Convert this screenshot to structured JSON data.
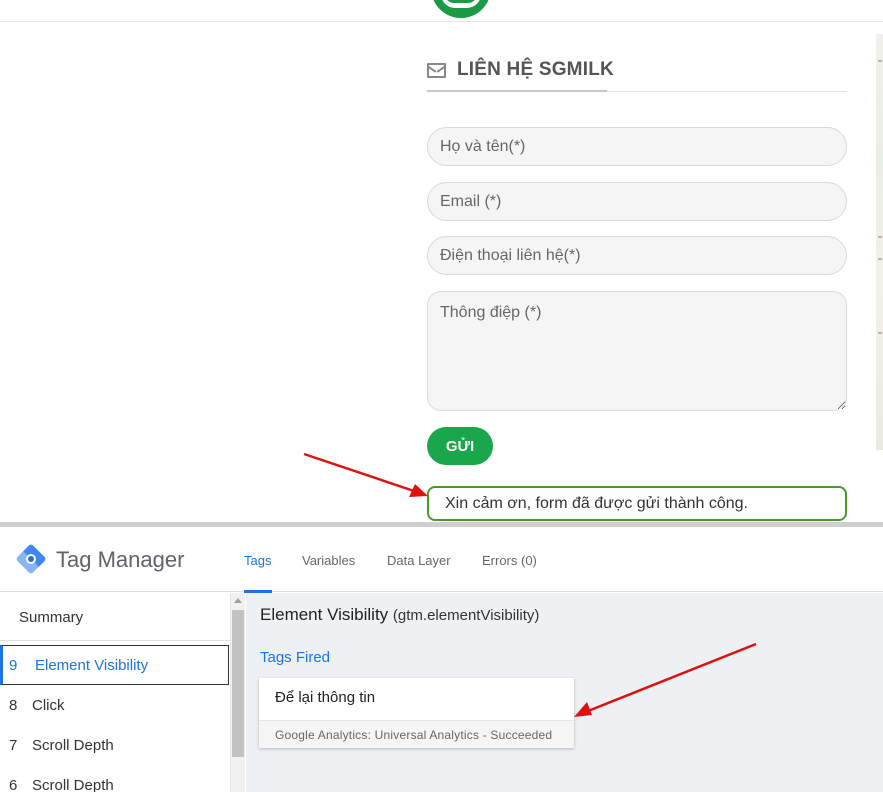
{
  "site": {
    "section_title": "LIÊN HỆ SGMILK",
    "form": {
      "name_placeholder": "Họ và tên(*)",
      "email_placeholder": "Email (*)",
      "phone_placeholder": "Điện thoại liên hệ(*)",
      "message_placeholder": "Thông điệp (*)",
      "submit_label": "GỬI",
      "success_message": "Xin cảm ơn, form đã được gửi thành công."
    },
    "colors": {
      "brand_green": "#1aa64a",
      "success_border": "#4a9a2a"
    }
  },
  "tag_manager": {
    "title": "Tag Manager",
    "tabs": [
      {
        "label": "Tags",
        "active": true
      },
      {
        "label": "Variables",
        "active": false
      },
      {
        "label": "Data Layer",
        "active": false
      },
      {
        "label": "Errors (0)",
        "active": false
      }
    ],
    "sidebar": {
      "summary_label": "Summary",
      "events": [
        {
          "num": "9",
          "label": "Element Visibility",
          "active": true
        },
        {
          "num": "8",
          "label": "Click",
          "active": false
        },
        {
          "num": "7",
          "label": "Scroll Depth",
          "active": false
        },
        {
          "num": "6",
          "label": "Scroll Depth",
          "active": false
        }
      ]
    },
    "main": {
      "event_name": "Element Visibility",
      "event_key": "(gtm.elementVisibility)",
      "tags_fired_label": "Tags Fired",
      "tag": {
        "name": "Để lại thông tin",
        "status": "Google Analytics: Universal Analytics - Succeeded"
      }
    },
    "colors": {
      "accent": "#1a73e8"
    }
  },
  "icons": {
    "section_icon": "envelope-icon",
    "logo": "tag-manager-logo-icon",
    "site_logo": "sgmilk-logo-icon"
  }
}
